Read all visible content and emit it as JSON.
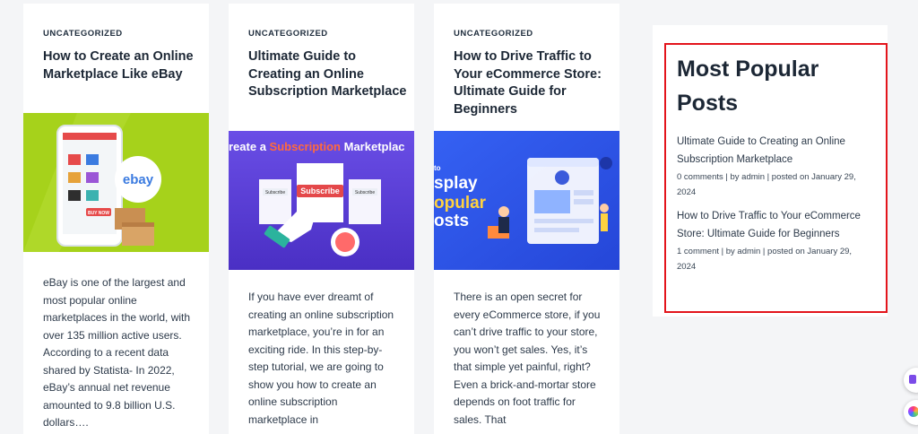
{
  "posts": [
    {
      "category": "UNCATEGORIZED",
      "title": "How to Create an Online Marketplace Like eBay",
      "excerpt": "eBay is one of the largest and most popular online marketplaces in the world, with over 135 million active users. According to a recent data shared by Statista- In 2022, eBay’s annual net revenue amounted to 9.8 billion U.S. dollars….",
      "image_text": "ebay",
      "image_badge": "BUY NOW"
    },
    {
      "category": "UNCATEGORIZED",
      "title": "Ultimate Guide to Creating an Online Subscription Marketplace",
      "excerpt": "If you have ever dreamt of creating an online subscription marketplace, you’re in for an exciting ride. In this step-by-step tutorial, we are going to show you how to create an online subscription marketplace in",
      "image_text_prefix": "reate a ",
      "image_text_accent": "Subscription",
      "image_text_suffix": " Marketplac",
      "image_button_main": "Subscribe",
      "image_button_side": "Subscribe"
    },
    {
      "category": "UNCATEGORIZED",
      "title": "How to Drive Traffic to Your eCommerce Store: Ultimate Guide for Beginners",
      "excerpt": "There is an open secret for every eCommerce store, if you can’t drive traffic to your store, you won’t get sales. Yes, it’s that simple yet painful, right? Even a brick-and-mortar store depends on foot traffic for sales. That",
      "image_line1": "to",
      "image_line2": "splay",
      "image_line3": "opular",
      "image_line4": "osts"
    }
  ],
  "widget": {
    "title": "Most Popular Posts",
    "items": [
      {
        "title": "Ultimate Guide to Creating an Online Subscription Marketplace",
        "meta": "0 comments | by admin | posted on January 29, 2024"
      },
      {
        "title": "How to Drive Traffic to Your eCommerce Store: Ultimate Guide for Beginners",
        "meta": "1 comment | by admin | posted on January 29, 2024"
      }
    ]
  },
  "colors": {
    "highlight_border": "#e3141b",
    "ebay_bg": "#a6d21b",
    "subscription_bg": "#5a3fd6",
    "traffic_bg": "#2f55f0",
    "accent_orange": "#ff6a3d",
    "accent_yellow": "#ffd23f"
  }
}
